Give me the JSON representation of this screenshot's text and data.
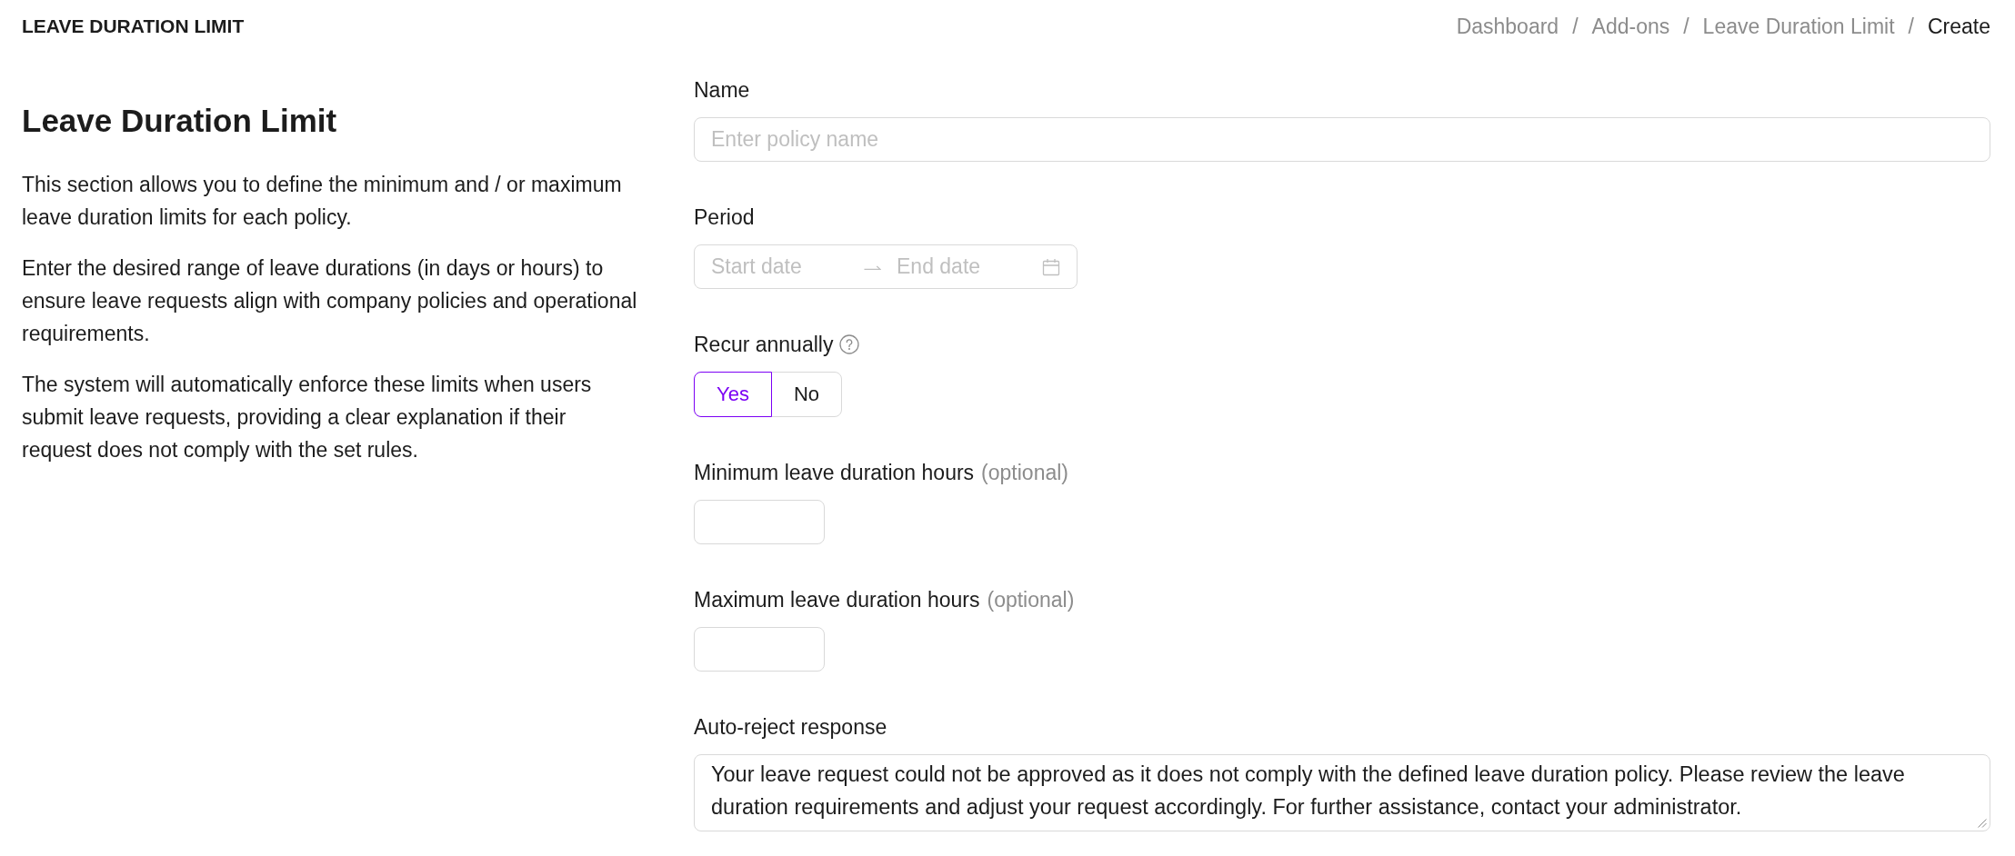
{
  "header": {
    "title": "LEAVE DURATION LIMIT",
    "breadcrumb": {
      "separator": "/",
      "items": [
        {
          "label": "Dashboard",
          "current": false
        },
        {
          "label": "Add-ons",
          "current": false
        },
        {
          "label": "Leave Duration Limit",
          "current": false
        },
        {
          "label": "Create",
          "current": true
        }
      ]
    }
  },
  "intro": {
    "title": "Leave Duration Limit",
    "paragraphs": [
      "This section allows you to define the minimum and / or maximum leave duration limits for each policy.",
      "Enter the desired range of leave durations (in days or hours) to ensure leave requests align with company policies and operational requirements.",
      "The system will automatically enforce these limits when users submit leave requests, providing a clear explanation if their request does not comply with the set rules."
    ]
  },
  "form": {
    "fields": [
      {
        "kind": "text",
        "label": "Name",
        "placeholder": "Enter policy name"
      },
      {
        "kind": "date_range",
        "label": "Period",
        "start_placeholder": "Start date",
        "end_placeholder": "End date"
      },
      {
        "kind": "toggle",
        "label": "Recur annually",
        "help": true,
        "options": [
          {
            "label": "Yes",
            "selected": true
          },
          {
            "label": "No",
            "selected": false
          }
        ]
      },
      {
        "kind": "number",
        "label": "Minimum leave duration hours",
        "note": "(optional)"
      },
      {
        "kind": "number",
        "label": "Maximum leave duration hours",
        "note": "(optional)"
      },
      {
        "kind": "textarea",
        "label": "Auto-reject response",
        "value": "Your leave request could not be approved as it does not comply with the defined leave duration policy. Please review the leave duration requirements and adjust your request accordingly. For further assistance, contact your administrator."
      }
    ]
  }
}
